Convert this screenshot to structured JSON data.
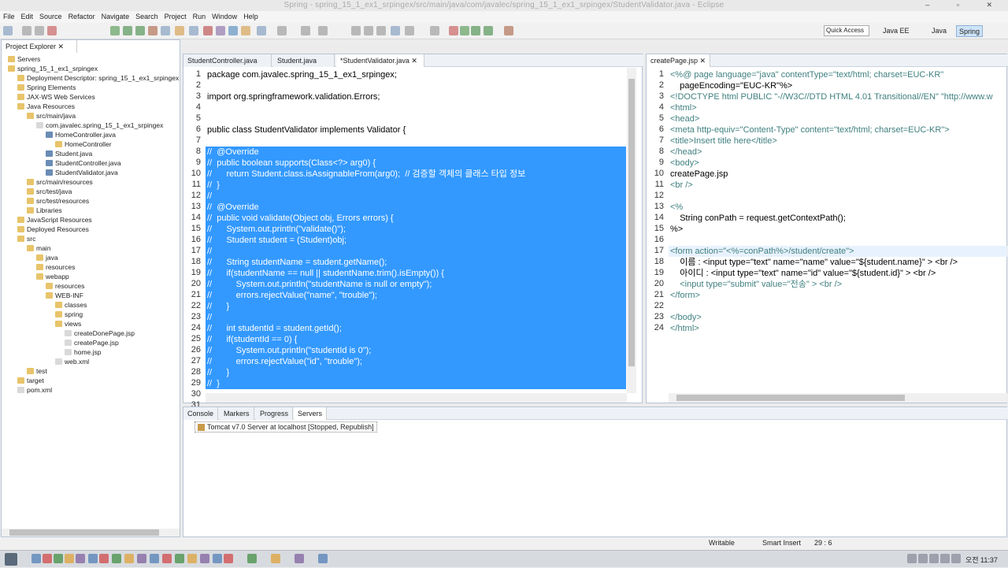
{
  "window": {
    "title": "Spring - spring_15_1_ex1_srpingex/src/main/java/com/javalec/spring_15_1_ex1_srpingex/StudentValidator.java - Eclipse"
  },
  "menu": [
    "File",
    "Edit",
    "Source",
    "Refactor",
    "Navigate",
    "Search",
    "Project",
    "Run",
    "Window",
    "Help"
  ],
  "toolbar": {
    "quick_access": "Quick Access",
    "perspectives": [
      "Java EE",
      "Java",
      "Spring"
    ]
  },
  "explorer": {
    "title": "Project Explorer",
    "items": [
      {
        "label": "Servers",
        "depth": 0
      },
      {
        "label": "spring_15_1_ex1_srpingex",
        "depth": 0
      },
      {
        "label": "Deployment Descriptor: spring_15_1_ex1_srpingex",
        "depth": 1
      },
      {
        "label": "Spring Elements",
        "depth": 1
      },
      {
        "label": "JAX-WS Web Services",
        "depth": 1
      },
      {
        "label": "Java Resources",
        "depth": 1
      },
      {
        "label": "src/main/java",
        "depth": 2
      },
      {
        "label": "com.javalec.spring_15_1_ex1_srpingex",
        "depth": 3
      },
      {
        "label": "HomeController.java",
        "depth": 4
      },
      {
        "label": "HomeController",
        "depth": 5
      },
      {
        "label": "Student.java",
        "depth": 4
      },
      {
        "label": "StudentController.java",
        "depth": 4
      },
      {
        "label": "StudentValidator.java",
        "depth": 4
      },
      {
        "label": "src/main/resources",
        "depth": 2
      },
      {
        "label": "src/test/java",
        "depth": 2
      },
      {
        "label": "src/test/resources",
        "depth": 2
      },
      {
        "label": "Libraries",
        "depth": 2
      },
      {
        "label": "JavaScript Resources",
        "depth": 1
      },
      {
        "label": "Deployed Resources",
        "depth": 1
      },
      {
        "label": "src",
        "depth": 1
      },
      {
        "label": "main",
        "depth": 2
      },
      {
        "label": "java",
        "depth": 3
      },
      {
        "label": "resources",
        "depth": 3
      },
      {
        "label": "webapp",
        "depth": 3
      },
      {
        "label": "resources",
        "depth": 4
      },
      {
        "label": "WEB-INF",
        "depth": 4
      },
      {
        "label": "classes",
        "depth": 5
      },
      {
        "label": "spring",
        "depth": 5
      },
      {
        "label": "views",
        "depth": 5
      },
      {
        "label": "createDonePage.jsp",
        "depth": 6
      },
      {
        "label": "createPage.jsp",
        "depth": 6
      },
      {
        "label": "home.jsp",
        "depth": 6
      },
      {
        "label": "web.xml",
        "depth": 5
      },
      {
        "label": "test",
        "depth": 2
      },
      {
        "label": "target",
        "depth": 1
      },
      {
        "label": "pom.xml",
        "depth": 1
      }
    ]
  },
  "editor": {
    "tabs": [
      "StudentController.java",
      "Student.java",
      "*StudentValidator.java"
    ],
    "lines": [
      {
        "n": "1",
        "t": "package com.javalec.spring_15_1_ex1_srpingex;"
      },
      {
        "n": "2",
        "t": ""
      },
      {
        "n": "3",
        "t": "import org.springframework.validation.Errors;"
      },
      {
        "n": "4",
        "t": ""
      },
      {
        "n": "5",
        "t": ""
      },
      {
        "n": "6",
        "t": "public class StudentValidator implements Validator {"
      },
      {
        "n": "7",
        "t": ""
      },
      {
        "n": "8",
        "t": "//  @Override"
      },
      {
        "n": "9",
        "t": "//  public boolean supports(Class<?> arg0) {"
      },
      {
        "n": "10",
        "t": "//      return Student.class.isAssignableFrom(arg0);  // 검증할 객체의 클래스 타입 정보"
      },
      {
        "n": "11",
        "t": "//  }"
      },
      {
        "n": "12",
        "t": "//"
      },
      {
        "n": "13",
        "t": "//  @Override"
      },
      {
        "n": "14",
        "t": "//  public void validate(Object obj, Errors errors) {"
      },
      {
        "n": "15",
        "t": "//      System.out.println(\"validate()\");"
      },
      {
        "n": "16",
        "t": "//      Student student = (Student)obj;"
      },
      {
        "n": "17",
        "t": "//"
      },
      {
        "n": "18",
        "t": "//      String studentName = student.getName();"
      },
      {
        "n": "19",
        "t": "//      if(studentName == null || studentName.trim().isEmpty()) {"
      },
      {
        "n": "20",
        "t": "//          System.out.println(\"studentName is null or empty\");"
      },
      {
        "n": "21",
        "t": "//          errors.rejectValue(\"name\", \"trouble\");"
      },
      {
        "n": "22",
        "t": "//      }"
      },
      {
        "n": "23",
        "t": "//"
      },
      {
        "n": "24",
        "t": "//      int studentId = student.getId();"
      },
      {
        "n": "25",
        "t": "//      if(studentId == 0) {"
      },
      {
        "n": "26",
        "t": "//          System.out.println(\"studentId is 0\");"
      },
      {
        "n": "27",
        "t": "//          errors.rejectValue(\"id\", \"trouble\");"
      },
      {
        "n": "28",
        "t": "//      }"
      },
      {
        "n": "29",
        "t": "//  }"
      },
      {
        "n": "30",
        "t": ""
      },
      {
        "n": "31",
        "t": "}"
      }
    ]
  },
  "jsp": {
    "tab": "createPage.jsp",
    "lines": [
      {
        "n": "1",
        "t": "<%@ page language=\"java\" contentType=\"text/html; charset=EUC-KR\""
      },
      {
        "n": "2",
        "t": "    pageEncoding=\"EUC-KR\"%>"
      },
      {
        "n": "3",
        "t": "<!DOCTYPE html PUBLIC \"-//W3C//DTD HTML 4.01 Transitional//EN\" \"http://www.w"
      },
      {
        "n": "4",
        "t": "<html>"
      },
      {
        "n": "5",
        "t": "<head>"
      },
      {
        "n": "6",
        "t": "<meta http-equiv=\"Content-Type\" content=\"text/html; charset=EUC-KR\">"
      },
      {
        "n": "7",
        "t": "<title>Insert title here</title>"
      },
      {
        "n": "8",
        "t": "</head>"
      },
      {
        "n": "9",
        "t": "<body>"
      },
      {
        "n": "10",
        "t": "createPage.jsp"
      },
      {
        "n": "11",
        "t": "<br />"
      },
      {
        "n": "12",
        "t": ""
      },
      {
        "n": "13",
        "t": "<%"
      },
      {
        "n": "14",
        "t": "    String conPath = request.getContextPath();"
      },
      {
        "n": "15",
        "t": "%>"
      },
      {
        "n": "16",
        "t": ""
      },
      {
        "n": "17",
        "t": "<form action=\"<%=conPath%>/student/create\">"
      },
      {
        "n": "18",
        "t": "    이름 : <input type=\"text\" name=\"name\" value=\"${student.name}\" > <br />"
      },
      {
        "n": "19",
        "t": "    아이디 : <input type=\"text\" name=\"id\" value=\"${student.id}\" > <br />"
      },
      {
        "n": "20",
        "t": "    <input type=\"submit\" value=\"전송\" > <br />"
      },
      {
        "n": "21",
        "t": "</form>"
      },
      {
        "n": "22",
        "t": ""
      },
      {
        "n": "23",
        "t": "</body>"
      },
      {
        "n": "24",
        "t": "</html>"
      }
    ]
  },
  "bottom": {
    "tabs": [
      "Console",
      "Markers",
      "Progress",
      "Servers"
    ],
    "server": "Tomcat v7.0 Server at localhost  [Stopped, Republish]"
  },
  "status": {
    "writable": "Writable",
    "insert": "Smart Insert",
    "pos": "29 : 6"
  },
  "taskbar": {
    "clock": "오전 11:37"
  }
}
